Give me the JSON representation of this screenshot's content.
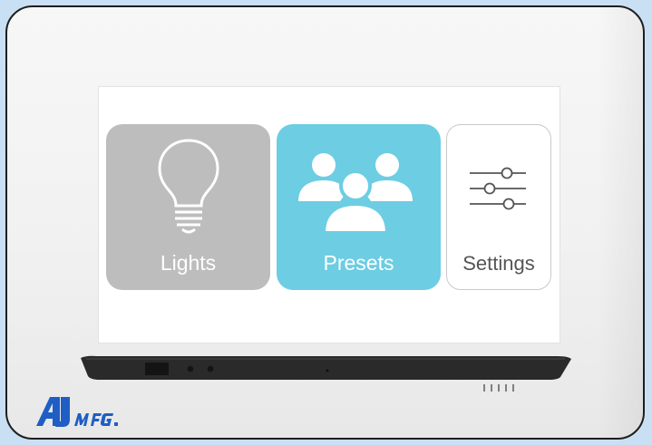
{
  "tiles": {
    "lights": {
      "label": "Lights",
      "icon": "lightbulb-icon",
      "color": "#bdbdbd"
    },
    "presets": {
      "label": "Presets",
      "icon": "group-icon",
      "color": "#6ccde3"
    },
    "settings": {
      "label": "Settings",
      "icon": "sliders-icon",
      "color": "#ffffff"
    }
  },
  "brand": {
    "logo_text": "AJ MFG."
  },
  "colors": {
    "background": "#c9dff3",
    "device": "#f3f3f3",
    "screen": "#ffffff"
  }
}
